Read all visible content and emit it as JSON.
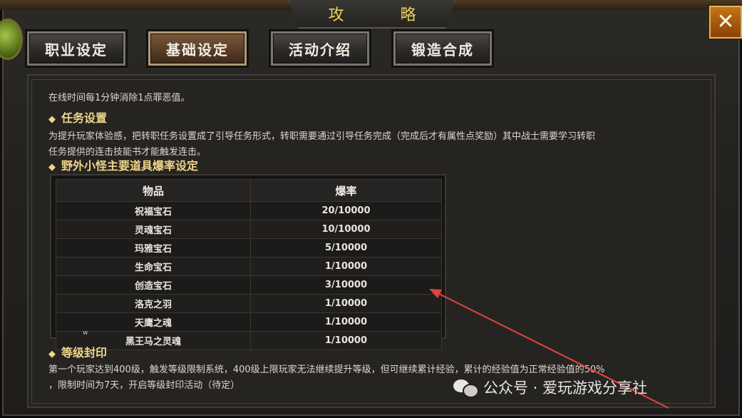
{
  "window": {
    "title": "攻 略",
    "close_icon": "close-x-icon"
  },
  "tabs": [
    {
      "label": "职业设定",
      "active": false
    },
    {
      "label": "基础设定",
      "active": true
    },
    {
      "label": "活动介绍",
      "active": false
    },
    {
      "label": "锻造合成",
      "active": false
    }
  ],
  "content": {
    "intro_line": "在线时间每1分钟消除1点罪恶值。",
    "section_task": {
      "heading": "任务设置",
      "line1": "为提升玩家体验感，把转职任务设置成了引导任务形式，转职需要通过引导任务完成（完成后才有属性点奖励）其中战士需要学习转职",
      "line2": "任务提供的连击技能书才能触发连击。"
    },
    "section_drop": {
      "heading": "野外小怪主要道具爆率设定",
      "columns": [
        "物品",
        "爆率"
      ],
      "rows": [
        {
          "item": "祝福宝石",
          "rate": "20/10000"
        },
        {
          "item": "灵魂宝石",
          "rate": "10/10000"
        },
        {
          "item": "玛雅宝石",
          "rate": "5/10000"
        },
        {
          "item": "生命宝石",
          "rate": "1/10000"
        },
        {
          "item": "创造宝石",
          "rate": "3/10000"
        },
        {
          "item": "洛克之羽",
          "rate": "1/10000"
        },
        {
          "item": "天鹰之魂",
          "rate": "1/10000"
        },
        {
          "item": "黑王马之灵魂",
          "rate": "1/10000"
        }
      ]
    },
    "section_level": {
      "heading": "等级封印",
      "line1": "第一个玩家达到400级，触发等级限制系统，400级上限玩家无法继续提升等级，但可继续累计经验，累计的经验值为正常经验值的50%",
      "line2": "，限制时间为7天，开启等级封印活动（待定）"
    },
    "stray_mark": "w"
  },
  "watermark": {
    "text": "公众号 · 爱玩游戏分享社",
    "icon": "wechat-icon"
  },
  "colors": {
    "title": "#e8d25a",
    "heading": "#f0d58a",
    "close_button": "#c4741a",
    "active_tab": "#5a3d27",
    "annotation_arrow": "#e0463c"
  }
}
